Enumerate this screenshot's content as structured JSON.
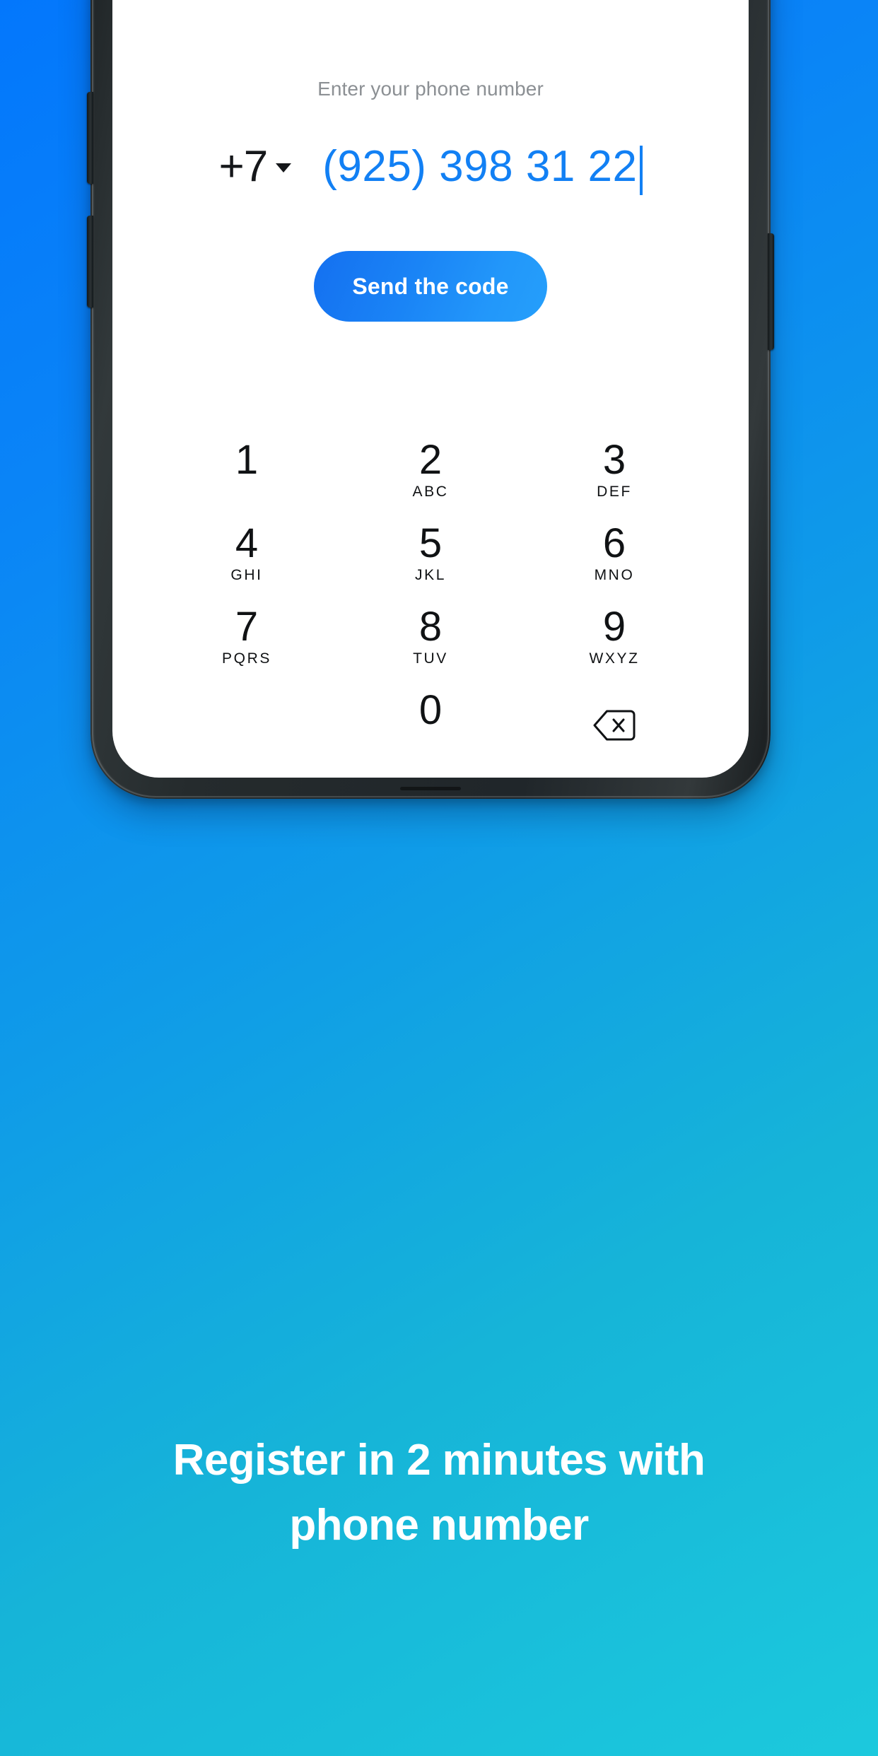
{
  "theme": {
    "background_gradient_start": "#0377FC",
    "background_gradient_end": "#1CC9DD",
    "accent_blue": "#1280F4",
    "button_gradient_start": "#1470F0",
    "button_gradient_end": "#259FFB",
    "label_gray": "#8C9094",
    "digit_black": "#101214",
    "screen_background": "#FFFFFF",
    "bezel_dark": "#252B2D"
  },
  "phone_screen": {
    "entry_label": "Enter your phone number",
    "country_code": "+7",
    "country_code_caret_icon": "chevron-down-icon",
    "phone_number": "(925) 398 31 22",
    "send_button_label": "Send the code",
    "dialpad": {
      "keys": [
        {
          "digit": "1",
          "letters": ""
        },
        {
          "digit": "2",
          "letters": "ABC"
        },
        {
          "digit": "3",
          "letters": "DEF"
        },
        {
          "digit": "4",
          "letters": "GHI"
        },
        {
          "digit": "5",
          "letters": "JKL"
        },
        {
          "digit": "6",
          "letters": "MNO"
        },
        {
          "digit": "7",
          "letters": "PQRS"
        },
        {
          "digit": "8",
          "letters": "TUV"
        },
        {
          "digit": "9",
          "letters": "WXYZ"
        },
        {
          "digit": "",
          "letters": ""
        },
        {
          "digit": "0",
          "letters": ""
        }
      ],
      "backspace_icon": "backspace-icon"
    }
  },
  "device": {
    "volume_up_button": "volume-up-button",
    "volume_down_button": "volume-down-button",
    "power_button": "power-button"
  },
  "caption": {
    "line1": "Register in 2 minutes with",
    "line2": "phone number"
  }
}
